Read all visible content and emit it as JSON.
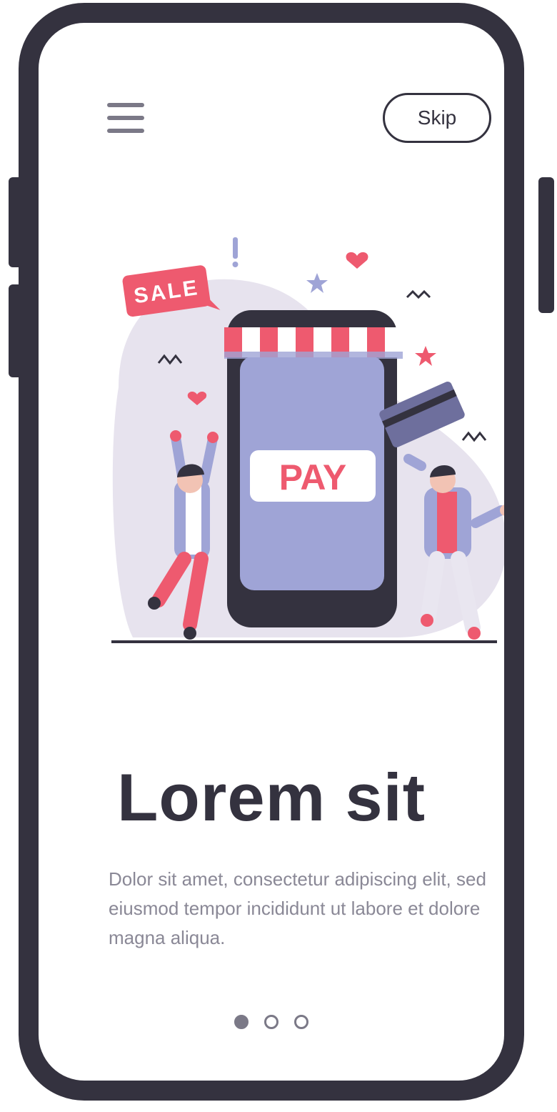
{
  "header": {
    "skip_label": "Skip"
  },
  "illustration": {
    "sale_label": "SALE",
    "pay_label": "PAY"
  },
  "content": {
    "title": "Lorem sit",
    "body": "Dolor sit amet, consectetur adipiscing elit, sed eiusmod tempor incididunt ut labore et dolore magna aliqua."
  },
  "pagination": {
    "total": 3,
    "active": 1
  },
  "colors": {
    "frame": "#34323f",
    "accent_red": "#ee5a6f",
    "periwinkle": "#9fa4d6",
    "blob": "#e7e3ee",
    "muted_text": "#8a8896"
  }
}
